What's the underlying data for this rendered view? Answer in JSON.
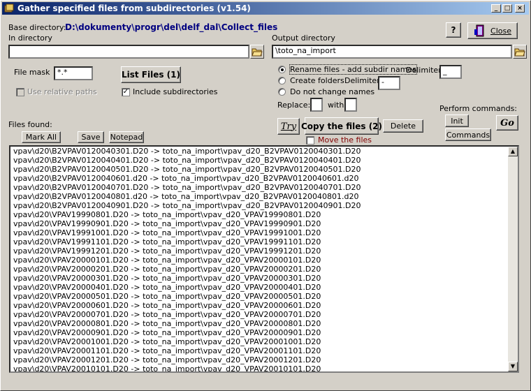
{
  "window": {
    "title": "Gather specified files from subdirectories  (v1.54)",
    "min_glyph": "_",
    "max_glyph": "□",
    "close_glyph": "×"
  },
  "base": {
    "label": "Base directory:",
    "value": "D:\\dokumenty\\progr\\del\\delf_dal\\Collect_files"
  },
  "help_label": "?",
  "close_label": "Close",
  "in_directory": {
    "label": "In directory",
    "value": ""
  },
  "output_directory": {
    "label": "Output directory",
    "value": "\\toto_na_import"
  },
  "file_mask": {
    "label": "File mask",
    "value": "*.*"
  },
  "list_files_label": "List Files (1)",
  "use_relative_paths": {
    "label": "Use relative paths",
    "checked": false,
    "disabled": true
  },
  "include_subdirectories": {
    "label": "Include subdirectories",
    "checked": true
  },
  "rename_options": {
    "rename": {
      "label": "Rename files - add subdir names",
      "selected": true
    },
    "create": {
      "label": "Create folders",
      "selected": false
    },
    "nochange": {
      "label": "Do not change names",
      "selected": false
    }
  },
  "delimiter_label": "Delimiter",
  "delimiter_value": "_",
  "folders_delimiter_label": "Delimiter",
  "folders_delimiter_value": "-",
  "replace_label": "Replace:",
  "replace_value": "",
  "with_label": "with",
  "with_value": "",
  "perform_commands_label": "Perform commands:",
  "init_label": "Init",
  "commands_label": "Commands",
  "go_label": "Go",
  "try_label": "Try",
  "copy_label": "Copy the files (2)",
  "delete_label": "Delete",
  "move_files": {
    "label": "Move the files",
    "checked": false
  },
  "files_found_label": "Files found:",
  "mark_all_label": "Mark All",
  "save_label": "Save",
  "notepad_label": "Notepad",
  "files": [
    "vpav\\d20\\B2VPAV0120040301.D20 -> toto_na_import\\vpav_d20_B2VPAV0120040301.D20",
    "vpav\\d20\\B2VPAV0120040401.D20 -> toto_na_import\\vpav_d20_B2VPAV0120040401.D20",
    "vpav\\d20\\B2VPAV0120040501.D20 -> toto_na_import\\vpav_d20_B2VPAV0120040501.D20",
    "vpav\\d20\\B2VPAV0120040601.d20 -> toto_na_import\\vpav_d20_B2VPAV0120040601.d20",
    "vpav\\d20\\B2VPAV0120040701.D20 -> toto_na_import\\vpav_d20_B2VPAV0120040701.D20",
    "vpav\\d20\\B2VPAV0120040801.d20 -> toto_na_import\\vpav_d20_B2VPAV0120040801.d20",
    "vpav\\d20\\B2VPAV0120040901.D20 -> toto_na_import\\vpav_d20_B2VPAV0120040901.D20",
    "vpav\\d20\\VPAV19990801.D20 -> toto_na_import\\vpav_d20_VPAV19990801.D20",
    "vpav\\d20\\VPAV19990901.D20 -> toto_na_import\\vpav_d20_VPAV19990901.D20",
    "vpav\\d20\\VPAV19991001.D20 -> toto_na_import\\vpav_d20_VPAV19991001.D20",
    "vpav\\d20\\VPAV19991101.D20 -> toto_na_import\\vpav_d20_VPAV19991101.D20",
    "vpav\\d20\\VPAV19991201.D20 -> toto_na_import\\vpav_d20_VPAV19991201.D20",
    "vpav\\d20\\VPAV20000101.D20 -> toto_na_import\\vpav_d20_VPAV20000101.D20",
    "vpav\\d20\\VPAV20000201.D20 -> toto_na_import\\vpav_d20_VPAV20000201.D20",
    "vpav\\d20\\VPAV20000301.D20 -> toto_na_import\\vpav_d20_VPAV20000301.D20",
    "vpav\\d20\\VPAV20000401.D20 -> toto_na_import\\vpav_d20_VPAV20000401.D20",
    "vpav\\d20\\VPAV20000501.D20 -> toto_na_import\\vpav_d20_VPAV20000501.D20",
    "vpav\\d20\\VPAV20000601.D20 -> toto_na_import\\vpav_d20_VPAV20000601.D20",
    "vpav\\d20\\VPAV20000701.D20 -> toto_na_import\\vpav_d20_VPAV20000701.D20",
    "vpav\\d20\\VPAV20000801.D20 -> toto_na_import\\vpav_d20_VPAV20000801.D20",
    "vpav\\d20\\VPAV20000901.D20 -> toto_na_import\\vpav_d20_VPAV20000901.D20",
    "vpav\\d20\\VPAV20001001.D20 -> toto_na_import\\vpav_d20_VPAV20001001.D20",
    "vpav\\d20\\VPAV20001101.D20 -> toto_na_import\\vpav_d20_VPAV20001101.D20",
    "vpav\\d20\\VPAV20001201.D20 -> toto_na_import\\vpav_d20_VPAV20001201.D20",
    "vpav\\d20\\VPAV20010101.D20 -> toto_na_import\\vpav_d20_VPAV20010101.D20"
  ],
  "scroll_up_glyph": "▲",
  "scroll_down_glyph": "▼",
  "colors": {
    "title_start": "#0a246a",
    "title_end": "#a6caf0",
    "base_dir": "#000080",
    "move_files": "#800000",
    "face": "#d4d0c8"
  },
  "icons": [
    "app-icon",
    "folder-open-icon",
    "exit-door-icon"
  ]
}
